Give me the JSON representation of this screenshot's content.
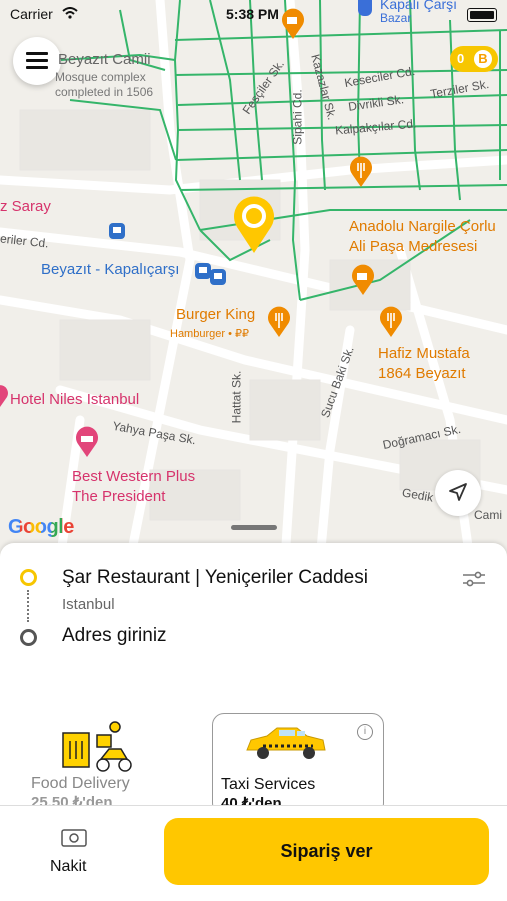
{
  "status_bar": {
    "carrier": "Carrier",
    "time": "5:38 PM"
  },
  "map": {
    "coin_count": "0",
    "coin_symbol": "B",
    "google_logo": "Google",
    "pois": [
      {
        "id": "beyazit-camii",
        "text": "Beyazıt Camii",
        "color": "#666666"
      },
      {
        "id": "beyazit-camii-desc",
        "text": "Mosque complex\ncompleted in 1506",
        "color": "#666666"
      },
      {
        "id": "kapali-carsi",
        "text": "Kapalı Çarşı",
        "color": "#3a6fd8"
      },
      {
        "id": "kapali-bazar",
        "text": "Bazar",
        "color": "#3a6fd8"
      },
      {
        "id": "saray",
        "text": "z Saray",
        "color": "#d6336c"
      },
      {
        "id": "anadolu-nargile",
        "text": "Anadolu Nargile Çorlu\nAli Paşa Medresesi",
        "color": "#e07b00"
      },
      {
        "id": "beyazit-kapalicarsi",
        "text": "Beyazıt - Kapalıçarşı",
        "color": "#2f6fc8"
      },
      {
        "id": "burger-king",
        "text": "Burger King",
        "color": "#e07b00"
      },
      {
        "id": "burger-king-sub",
        "text": "Hamburger • ₽₽",
        "color": "#e07b00"
      },
      {
        "id": "hafiz-mustafa",
        "text": "Hafiz Mustafa\n1864 Beyazıt",
        "color": "#e07b00"
      },
      {
        "id": "hotel-niles",
        "text": "Hotel Niles Istanbul",
        "color": "#d6336c"
      },
      {
        "id": "best-western",
        "text": "Best Western Plus\nThe President",
        "color": "#d6336c"
      }
    ],
    "streets": [
      {
        "id": "fesciler",
        "text": "Fesçiler Sk."
      },
      {
        "id": "sipahi",
        "text": "Sipahi Cd."
      },
      {
        "id": "kazazlar",
        "text": "Kazazlar Sk."
      },
      {
        "id": "keseciler",
        "text": "Keseciler Cd."
      },
      {
        "id": "divrikli",
        "text": "Divrikli Sk."
      },
      {
        "id": "terziler",
        "text": "Terziler Sk."
      },
      {
        "id": "kalpakcilar",
        "text": "Kalpakçılar Cd."
      },
      {
        "id": "yeniceriler",
        "text": "eriler Cd."
      },
      {
        "id": "hattat",
        "text": "Hattat Sk."
      },
      {
        "id": "sucu-baki",
        "text": "Sucu Baki Sk."
      },
      {
        "id": "yahya-pasa",
        "text": "Yahya Paşa Sk."
      },
      {
        "id": "dogramaci",
        "text": "Doğramacı Sk."
      },
      {
        "id": "gedik",
        "text": "Gedik"
      },
      {
        "id": "cami",
        "text": "Cami"
      }
    ]
  },
  "sheet": {
    "pickup_title": "Şar Restaurant | Yeniçeriler Caddesi",
    "pickup_subtitle": "Istanbul",
    "destination_placeholder": "Adres giriniz",
    "services": [
      {
        "label": "Food Delivery",
        "price": "25.50 ₺'den",
        "selected": false
      },
      {
        "label": "Taxi Services",
        "price": "40 ₺'den",
        "selected": true
      }
    ]
  },
  "bottom": {
    "payment_label": "Nakit",
    "order_button": "Sipariş ver"
  },
  "colors": {
    "accent": "#ffc700",
    "road": "#ffffff",
    "transit_line": "#35b56a"
  }
}
